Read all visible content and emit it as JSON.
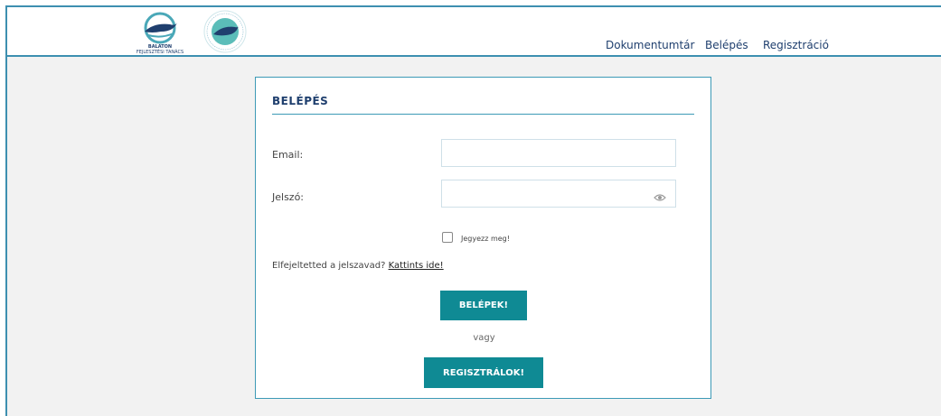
{
  "header": {
    "logo1_caption_line1": "BALATON",
    "logo1_caption_line2": "FEJLESZTÉSI TANÁCS",
    "nav": [
      "Dokumentumtár",
      "Belépés",
      "Regisztráció"
    ]
  },
  "login": {
    "title": "BELÉPÉS",
    "email_label": "Email:",
    "email_value": "",
    "password_label": "Jelszó:",
    "password_value": "",
    "remember_label": "Jegyezz meg!",
    "remember_checked": false,
    "forgot_text": "Elfejeltetted a jelszavad?",
    "forgot_link": "Kattints ide!",
    "login_button": "BELÉPEK!",
    "or_text": "vagy",
    "register_button": "REGISZTRÁLOK!"
  },
  "colors": {
    "accent": "#0f8a94",
    "border": "#3d9ab6",
    "navy": "#1f3f6e",
    "background": "#f2f2f2"
  },
  "icons": [
    "balaton-logo-icon",
    "seal-logo-icon",
    "eye-icon",
    "checkbox"
  ]
}
